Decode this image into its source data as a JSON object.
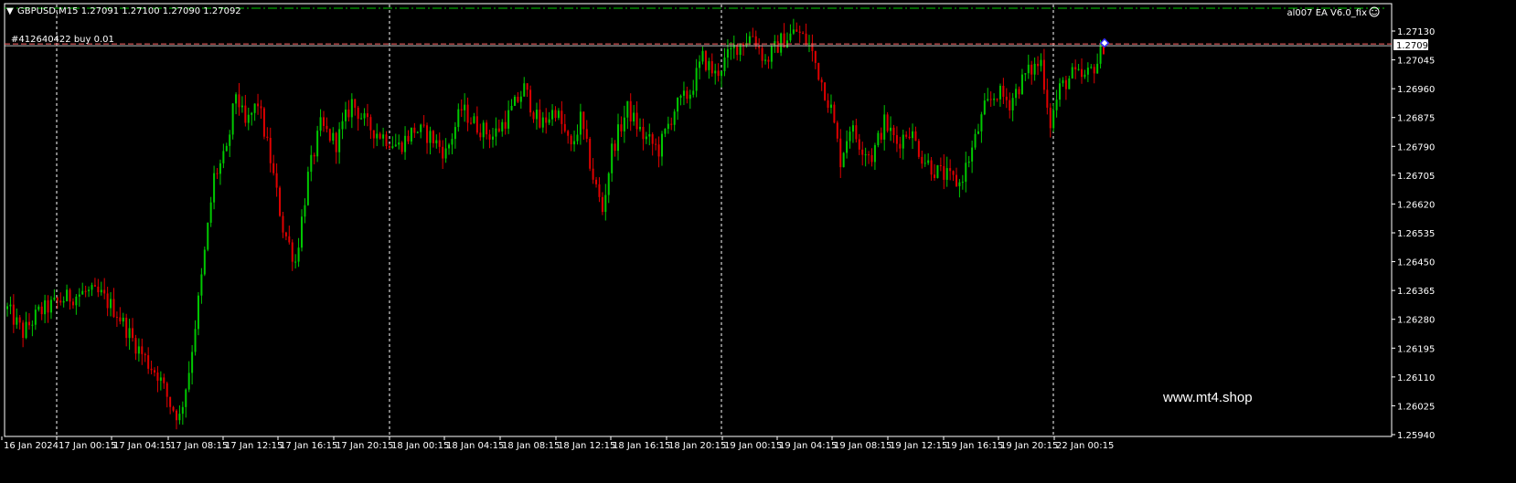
{
  "header": {
    "symbol_line": "GBPUSD,M15  1.27091 1.27100 1.27090 1.27092",
    "ea_label": "al007 EA V6.0_fix",
    "order_label": "#412640422 buy 0.01",
    "watermark": "www.mt4.shop"
  },
  "colors": {
    "background": "#000000",
    "bull": "#00c800",
    "bear": "#e00000",
    "grid": "#ffffff",
    "order_line": "#ff6464",
    "bid_line": "#c0c0c0",
    "top_line": "#00c800",
    "price_tag_bg": "#ffffff",
    "price_tag_fg": "#000000"
  },
  "chart_data": {
    "type": "candlestick",
    "timeframe": "M15",
    "y_ticks": [
      "1.27130",
      "1.27045",
      "1.26960",
      "1.26875",
      "1.26790",
      "1.26705",
      "1.26620",
      "1.26535",
      "1.26450",
      "1.26365",
      "1.26280",
      "1.26195",
      "1.26110",
      "1.26025",
      "1.25940"
    ],
    "ylim": [
      1.2594,
      1.2713
    ],
    "x_ticks": [
      "16 Jan 2024",
      "17 Jan 00:15",
      "17 Jan 04:15",
      "17 Jan 08:15",
      "17 Jan 12:15",
      "17 Jan 16:15",
      "17 Jan 20:15",
      "18 Jan 00:15",
      "18 Jan 04:15",
      "18 Jan 08:15",
      "18 Jan 12:15",
      "18 Jan 16:15",
      "18 Jan 20:15",
      "19 Jan 00:15",
      "19 Jan 04:15",
      "19 Jan 08:15",
      "19 Jan 12:15",
      "19 Jan 16:15",
      "19 Jan 20:15",
      "22 Jan 00:15"
    ],
    "current_price": "1.27092",
    "order_price": 1.27092,
    "close_path": [
      [
        0,
        1.2631
      ],
      [
        5,
        1.2624
      ],
      [
        10,
        1.263
      ],
      [
        18,
        1.2634
      ],
      [
        25,
        1.2636
      ],
      [
        30,
        1.2635
      ],
      [
        35,
        1.263
      ],
      [
        40,
        1.2622
      ],
      [
        45,
        1.2615
      ],
      [
        48,
        1.2612
      ],
      [
        52,
        1.2603
      ],
      [
        55,
        1.2599
      ],
      [
        58,
        1.2613
      ],
      [
        62,
        1.264
      ],
      [
        66,
        1.267
      ],
      [
        70,
        1.2677
      ],
      [
        73,
        1.2695
      ],
      [
        76,
        1.2685
      ],
      [
        80,
        1.2692
      ],
      [
        84,
        1.2675
      ],
      [
        88,
        1.2655
      ],
      [
        92,
        1.2645
      ],
      [
        96,
        1.267
      ],
      [
        100,
        1.2685
      ],
      [
        105,
        1.268
      ],
      [
        110,
        1.2692
      ],
      [
        115,
        1.2685
      ],
      [
        120,
        1.2682
      ],
      [
        125,
        1.2679
      ],
      [
        130,
        1.2684
      ],
      [
        135,
        1.2682
      ],
      [
        140,
        1.2677
      ],
      [
        145,
        1.269
      ],
      [
        150,
        1.2685
      ],
      [
        155,
        1.2682
      ],
      [
        160,
        1.2688
      ],
      [
        165,
        1.2696
      ],
      [
        170,
        1.2685
      ],
      [
        175,
        1.269
      ],
      [
        180,
        1.2678
      ],
      [
        183,
        1.2687
      ],
      [
        187,
        1.267
      ],
      [
        190,
        1.266
      ],
      [
        193,
        1.2678
      ],
      [
        198,
        1.269
      ],
      [
        203,
        1.2682
      ],
      [
        208,
        1.2678
      ],
      [
        213,
        1.269
      ],
      [
        218,
        1.2695
      ],
      [
        222,
        1.2705
      ],
      [
        226,
        1.27
      ],
      [
        232,
        1.2708
      ],
      [
        238,
        1.2712
      ],
      [
        242,
        1.2704
      ],
      [
        247,
        1.271
      ],
      [
        252,
        1.2713
      ],
      [
        256,
        1.2709
      ],
      [
        260,
        1.2698
      ],
      [
        263,
        1.269
      ],
      [
        266,
        1.2675
      ],
      [
        269,
        1.2685
      ],
      [
        272,
        1.268
      ],
      [
        276,
        1.2676
      ],
      [
        280,
        1.2686
      ],
      [
        284,
        1.268
      ],
      [
        288,
        1.2684
      ],
      [
        292,
        1.2676
      ],
      [
        296,
        1.2672
      ],
      [
        300,
        1.267
      ],
      [
        304,
        1.2668
      ],
      [
        308,
        1.2678
      ],
      [
        312,
        1.269
      ],
      [
        316,
        1.2695
      ],
      [
        320,
        1.2692
      ],
      [
        325,
        1.27
      ],
      [
        330,
        1.2704
      ],
      [
        333,
        1.2686
      ],
      [
        336,
        1.2696
      ],
      [
        340,
        1.27
      ],
      [
        344,
        1.2699
      ],
      [
        348,
        1.2704
      ],
      [
        350,
        1.2709
      ]
    ]
  }
}
